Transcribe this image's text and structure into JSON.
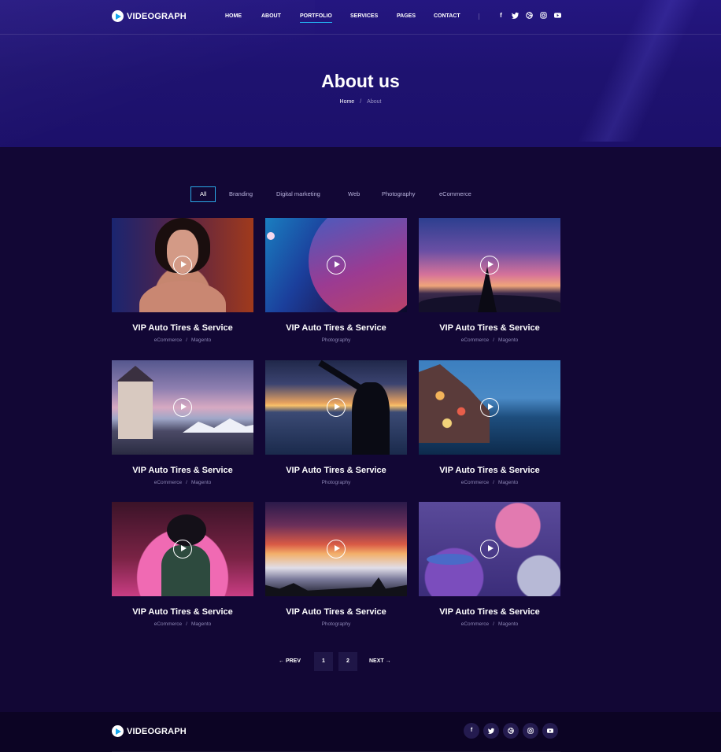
{
  "header": {
    "brand": "VIDEOGRAPH",
    "nav": [
      "HOME",
      "ABOUT",
      "PORTFOLIO",
      "SERVICES",
      "PAGES",
      "CONTACT"
    ],
    "active_nav": "PORTFOLIO",
    "social_icons": [
      "facebook-icon",
      "twitter-icon",
      "dribbble-icon",
      "instagram-icon",
      "youtube-icon"
    ]
  },
  "hero": {
    "title": "About us",
    "breadcrumb_home": "Home",
    "breadcrumb_separator": "/",
    "breadcrumb_current": "About"
  },
  "filters": [
    "All",
    "Branding",
    "Digital marketing",
    "Web",
    "Photography",
    "eCommerce"
  ],
  "active_filter": "All",
  "portfolio": [
    {
      "title": "VIP Auto Tires & Service",
      "categories": [
        "eCommerce",
        "Magento"
      ]
    },
    {
      "title": "VIP Auto Tires & Service",
      "categories": [
        "Photography"
      ]
    },
    {
      "title": "VIP Auto Tires & Service",
      "categories": [
        "eCommerce",
        "Magento"
      ]
    },
    {
      "title": "VIP Auto Tires & Service",
      "categories": [
        "eCommerce",
        "Magento"
      ]
    },
    {
      "title": "VIP Auto Tires & Service",
      "categories": [
        "Photography"
      ]
    },
    {
      "title": "VIP Auto Tires & Service",
      "categories": [
        "eCommerce",
        "Magento"
      ]
    },
    {
      "title": "VIP Auto Tires & Service",
      "categories": [
        "eCommerce",
        "Magento"
      ]
    },
    {
      "title": "VIP Auto Tires & Service",
      "categories": [
        "Photography"
      ]
    },
    {
      "title": "VIP Auto Tires & Service",
      "categories": [
        "eCommerce",
        "Magento"
      ]
    }
  ],
  "pagination": {
    "prev": "← PREV",
    "pages": [
      "1",
      "2"
    ],
    "next": "NEXT →"
  },
  "footer": {
    "brand": "VIDEOGRAPH",
    "social_icons": [
      "facebook-icon",
      "twitter-icon",
      "dribbble-icon",
      "instagram-icon",
      "youtube-icon"
    ]
  },
  "colors": {
    "accent": "#24b3f2",
    "background": "#120735",
    "hero": "#1e1270"
  }
}
